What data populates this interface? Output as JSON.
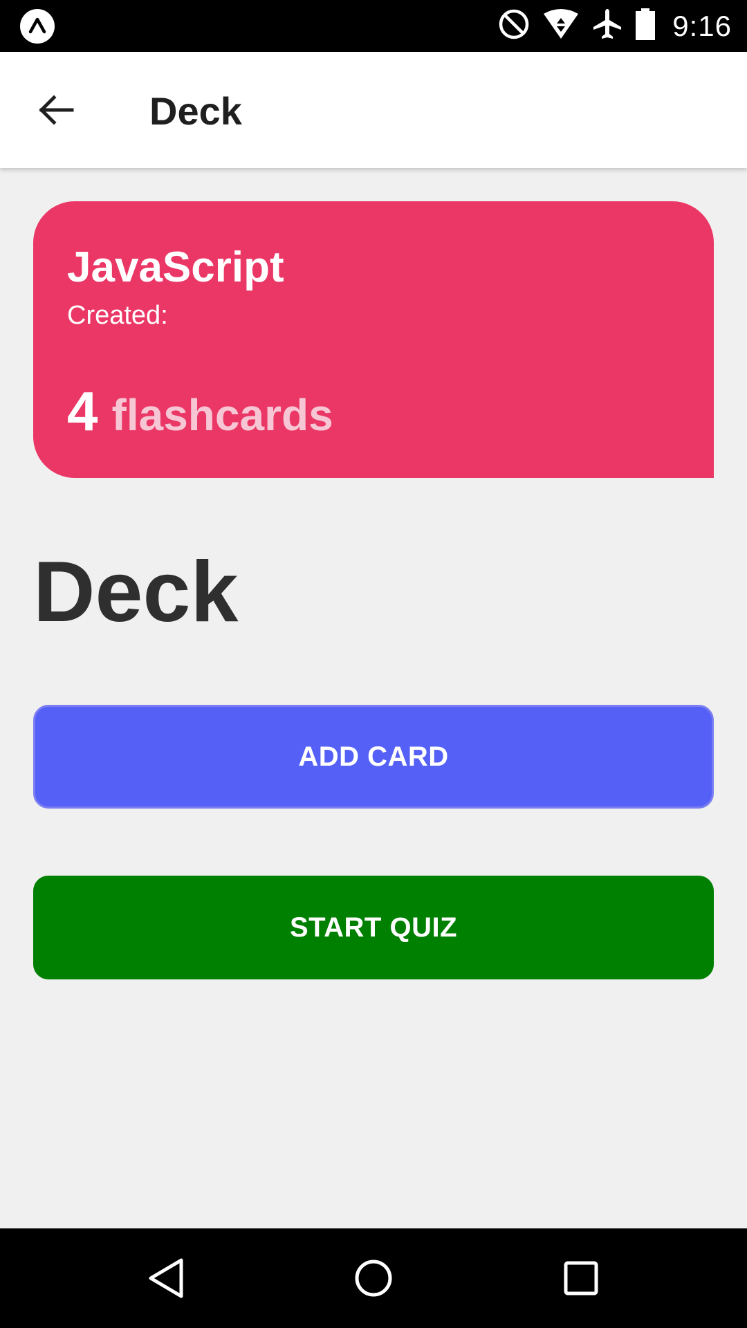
{
  "status_bar": {
    "time": "9:16",
    "icons": [
      "expo-icon",
      "do-not-disturb-icon",
      "wifi-icon",
      "airplane-mode-icon",
      "battery-icon"
    ]
  },
  "header": {
    "title": "Deck",
    "back_icon": "arrow-back-icon"
  },
  "deck_card": {
    "name": "JavaScript",
    "created_label": "Created:",
    "count": "4",
    "count_label": "flashcards",
    "background_color": "#ea3766"
  },
  "page": {
    "heading": "Deck"
  },
  "buttons": {
    "add_card": "ADD CARD",
    "start_quiz": "START QUIZ",
    "add_card_color": "#5560f6",
    "start_quiz_color": "#008000"
  },
  "nav_bar": {
    "icons": [
      "nav-back-icon",
      "nav-home-icon",
      "nav-recents-icon"
    ]
  }
}
